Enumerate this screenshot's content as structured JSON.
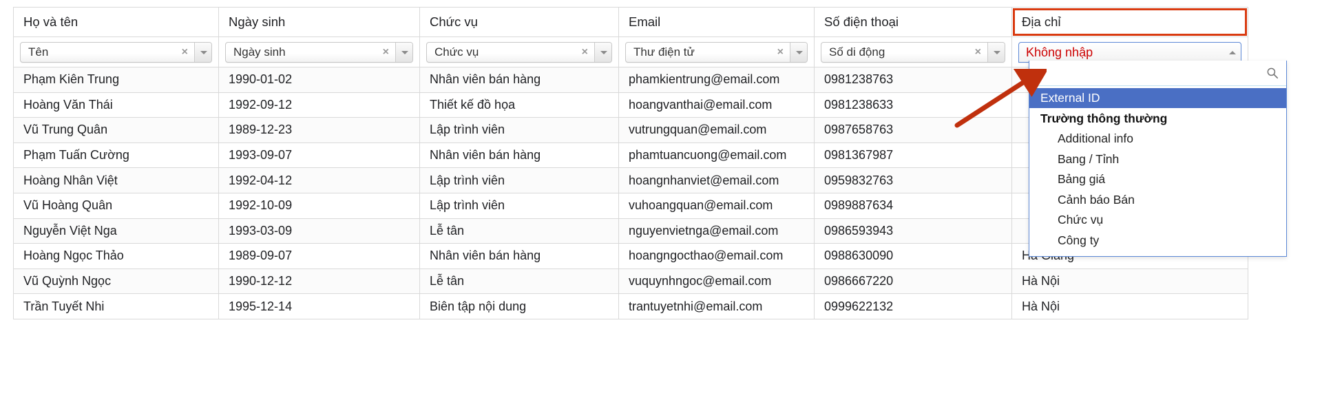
{
  "table": {
    "headers": [
      {
        "label": "Họ và tên",
        "highlighted": false
      },
      {
        "label": "Ngày sinh",
        "highlighted": false
      },
      {
        "label": "Chức vụ",
        "highlighted": false
      },
      {
        "label": "Email",
        "highlighted": false
      },
      {
        "label": "Số điện thoại",
        "highlighted": false
      },
      {
        "label": "Địa chỉ",
        "highlighted": true
      }
    ],
    "mapping_selects": [
      {
        "value": "Tên",
        "clear": "×",
        "open": false
      },
      {
        "value": "Ngày sinh",
        "clear": "×",
        "open": false
      },
      {
        "value": "Chức vụ",
        "clear": "×",
        "open": false
      },
      {
        "value": "Thư điện tử",
        "clear": "×",
        "open": false
      },
      {
        "value": "Số di động",
        "clear": "×",
        "open": false
      },
      {
        "value": "Không nhập",
        "clear": "",
        "open": true
      }
    ],
    "rows": [
      {
        "name": "Phạm Kiên Trung",
        "dob": "1990-01-02",
        "job": "Nhân viên bán hàng",
        "email": "phamkientrung@email.com",
        "phone": "0981238763",
        "address": ""
      },
      {
        "name": "Hoàng Văn Thái",
        "dob": "1992-09-12",
        "job": "Thiết kế đồ họa",
        "email": "hoangvanthai@email.com",
        "phone": "0981238633",
        "address": ""
      },
      {
        "name": "Vũ Trung Quân",
        "dob": "1989-12-23",
        "job": "Lập trình viên",
        "email": "vutrungquan@email.com",
        "phone": "0987658763",
        "address": ""
      },
      {
        "name": "Phạm Tuấn Cường",
        "dob": "1993-09-07",
        "job": "Nhân viên bán hàng",
        "email": "phamtuancuong@email.com",
        "phone": "0981367987",
        "address": ""
      },
      {
        "name": "Hoàng Nhân Việt",
        "dob": "1992-04-12",
        "job": "Lập trình viên",
        "email": "hoangnhanviet@email.com",
        "phone": "0959832763",
        "address": ""
      },
      {
        "name": "Vũ Hoàng Quân",
        "dob": "1992-10-09",
        "job": "Lập trình viên",
        "email": "vuhoangquan@email.com",
        "phone": "0989887634",
        "address": ""
      },
      {
        "name": "Nguyễn Việt Nga",
        "dob": "1993-03-09",
        "job": "Lễ tân",
        "email": "nguyenvietnga@email.com",
        "phone": "0986593943",
        "address": ""
      },
      {
        "name": "Hoàng Ngọc Thảo",
        "dob": "1989-09-07",
        "job": "Nhân viên bán hàng",
        "email": "hoangngocthao@email.com",
        "phone": "0988630090",
        "address": "Hà Giang"
      },
      {
        "name": "Vũ Quỳnh Ngọc",
        "dob": "1990-12-12",
        "job": "Lễ tân",
        "email": "vuquynhngoc@email.com",
        "phone": "0986667220",
        "address": "Hà Nội"
      },
      {
        "name": "Trần Tuyết Nhi",
        "dob": "1995-12-14",
        "job": "Biên tập nội dung",
        "email": "trantuyetnhi@email.com",
        "phone": "0999622132",
        "address": "Hà Nội"
      }
    ]
  },
  "dropdown": {
    "search_value": "",
    "search_placeholder": "",
    "selected_option": "External ID",
    "group_label": "Trường thông thường",
    "options": [
      "Additional info",
      "Bang / Tỉnh",
      "Bảng giá",
      "Cảnh báo Bán",
      "Chức vụ",
      "Công ty"
    ]
  },
  "colors": {
    "highlight_border": "#d93a10",
    "arrow": "#c0300d",
    "selected_option_bg": "#4a6fc4",
    "open_select_text": "#cc0000",
    "open_select_border": "#5b87d6"
  }
}
